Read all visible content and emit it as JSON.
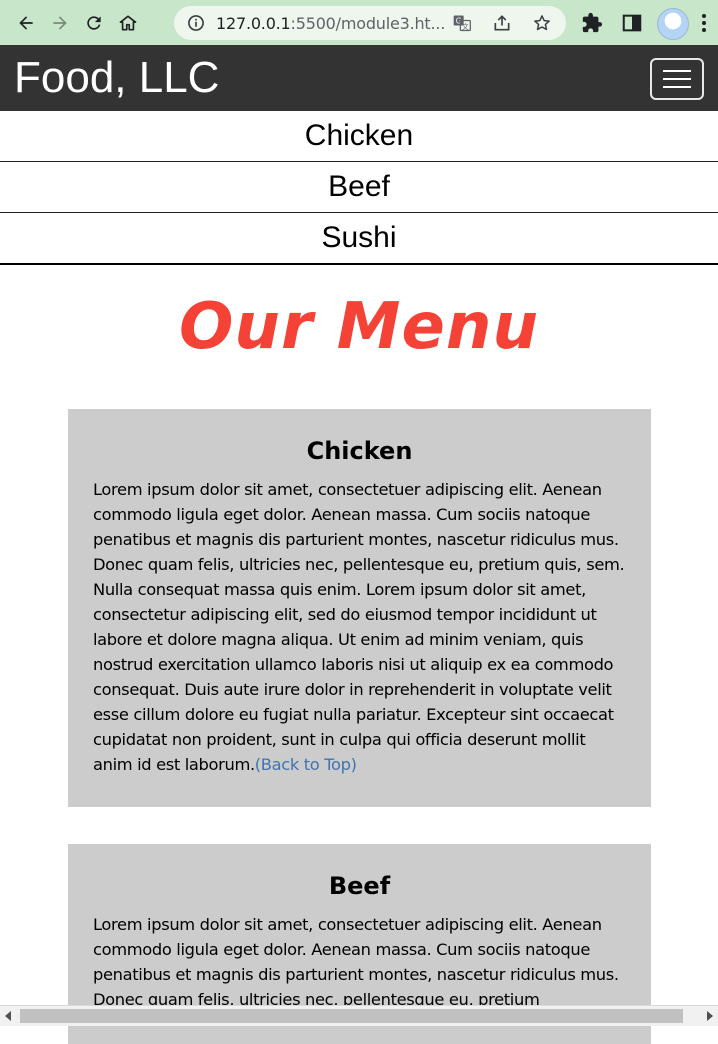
{
  "browser": {
    "url_host": "127.0.0.1",
    "url_rest": ":5500/module3.ht..."
  },
  "site": {
    "brand": "Food, LLC",
    "nav": [
      "Chicken",
      "Beef",
      "Sushi"
    ]
  },
  "page": {
    "title": "Our Menu",
    "sections": [
      {
        "heading": "Chicken",
        "body": "Lorem ipsum dolor sit amet, consectetuer adipiscing elit. Aenean commodo ligula eget dolor. Aenean massa. Cum sociis natoque penatibus et magnis dis parturient montes, nascetur ridiculus mus. Donec quam felis, ultricies nec, pellentesque eu, pretium quis, sem. Nulla consequat massa quis enim. Lorem ipsum dolor sit amet, consectetur adipiscing elit, sed do eiusmod tempor incididunt ut labore et dolore magna aliqua. Ut enim ad minim veniam, quis nostrud exercitation ullamco laboris nisi ut aliquip ex ea commodo consequat. Duis aute irure dolor in reprehenderit in voluptate velit esse cillum dolore eu fugiat nulla pariatur. Excepteur sint occaecat cupidatat non proident, sunt in culpa qui officia deserunt mollit anim id est laborum.",
        "link": "(Back to Top)"
      },
      {
        "heading": "Beef",
        "body": "Lorem ipsum dolor sit amet, consectetuer adipiscing elit. Aenean commodo ligula eget dolor. Aenean massa. Cum sociis natoque penatibus et magnis dis parturient montes, nascetur ridiculus mus. Donec quam felis, ultricies nec, pellentesque eu, pretium"
      }
    ]
  },
  "colors": {
    "header_bg": "#333333",
    "title": "#f44336",
    "section_bg": "#cccccc",
    "link": "#3f74b0",
    "chrome_bg": "#c8e6c9"
  },
  "icons": {
    "chrome": [
      "back-arrow-icon",
      "forward-arrow-icon",
      "reload-icon",
      "home-icon",
      "site-info-icon",
      "translate-icon",
      "share-icon",
      "bookmark-star-icon",
      "extensions-icon",
      "side-panel-icon",
      "profile-avatar",
      "menu-kebab-icon"
    ],
    "site": [
      "hamburger-menu-icon"
    ]
  }
}
